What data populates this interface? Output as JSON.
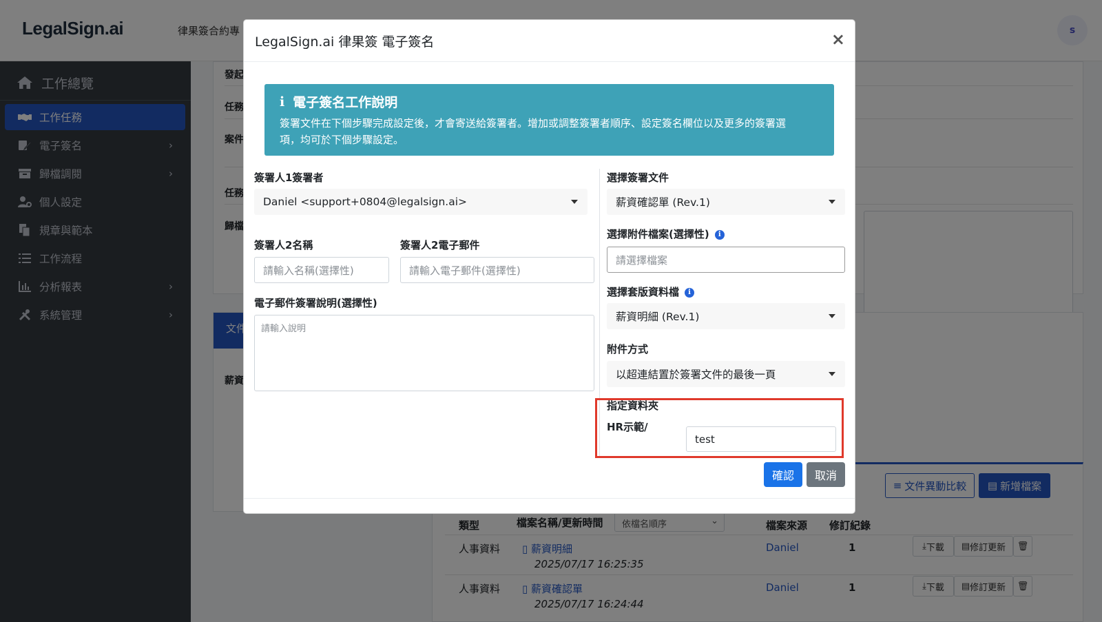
{
  "header": {
    "logo": "LegalSign.ai",
    "nav_text": "律果簽合約專",
    "avatar_letter": "s"
  },
  "sidebar": {
    "brand": "工作總覽",
    "items": [
      {
        "label": "工作任務",
        "icon": "handshake-icon",
        "active": true
      },
      {
        "label": "電子簽名",
        "icon": "signature-icon",
        "chevron": "›"
      },
      {
        "label": "歸檔調閱",
        "icon": "archive-icon",
        "chevron": "›"
      },
      {
        "label": "個人設定",
        "icon": "user-cog-icon"
      },
      {
        "label": "規章與範本",
        "icon": "copy-icon"
      },
      {
        "label": "工作流程",
        "icon": "tasks-icon"
      },
      {
        "label": "分析報表",
        "icon": "chart-bar-icon",
        "chevron": "›"
      },
      {
        "label": "系統管理",
        "icon": "tools-icon",
        "chevron": "›"
      }
    ]
  },
  "background": {
    "labels": [
      "發起",
      "任務",
      "案件",
      "任務",
      "歸檔"
    ],
    "tab": "文件",
    "row_label": "薪資",
    "compare_button": "文件異動比較",
    "add_file_button": "新增檔案",
    "table": {
      "headers": {
        "type": "類型",
        "name": "檔案名稱/更新時間",
        "source": "檔案來源",
        "revisions": "修訂紀錄"
      },
      "sort_option": "依檔名順序",
      "rows": [
        {
          "type": "人事資料",
          "name": "薪資明細",
          "time": "2025/07/17 16:25:35",
          "source": "Daniel",
          "revisions": "1"
        },
        {
          "type": "人事資料",
          "name": "薪資確認單",
          "time": "2025/07/17 16:24:44",
          "source": "Daniel",
          "revisions": "1"
        }
      ],
      "download_label": "下載",
      "update_label": "修訂更新"
    }
  },
  "modal": {
    "title": "LegalSign.ai 律果簽 電子簽名",
    "close": "×",
    "info": {
      "title": "電子簽名工作說明",
      "text_line1": "簽署文件在下個步驟完成設定後，才會寄送給簽署者。增加或調整簽署者順序、設定簽名欄位以及更多的簽署選",
      "text_line2": "項，均可於下個步驟設定。"
    },
    "signer1": {
      "label": "簽署人1簽署者",
      "value": "Daniel <support+0804@legalsign.ai>"
    },
    "signer2_name": {
      "label": "簽署人2名稱",
      "placeholder": "請輸入名稱(選擇性)"
    },
    "signer2_email": {
      "label": "簽署人2電子郵件",
      "placeholder": "請輸入電子郵件(選擇性)"
    },
    "email_note": {
      "label": "電子郵件簽署說明(選擇性)",
      "placeholder": "請輸入說明"
    },
    "doc": {
      "label": "選擇簽署文件",
      "value": "薪資確認單 (Rev.1)"
    },
    "attachment": {
      "label": "選擇附件檔案(選擇性)",
      "placeholder": "請選擇檔案"
    },
    "template": {
      "label": "選擇套版資料檔",
      "value": "薪資明細 (Rev.1)"
    },
    "attach_method": {
      "label": "附件方式",
      "value": "以超連結置於簽署文件的最後一頁"
    },
    "folder": {
      "label": "指定資料夾",
      "prefix": "HR示範/",
      "value": "test"
    },
    "confirm": "確認",
    "cancel": "取消"
  },
  "colors": {
    "primary": "#2456c3",
    "info": "#3ea2b7",
    "highlight": "#e0392b",
    "sidebar": "#343a40"
  }
}
